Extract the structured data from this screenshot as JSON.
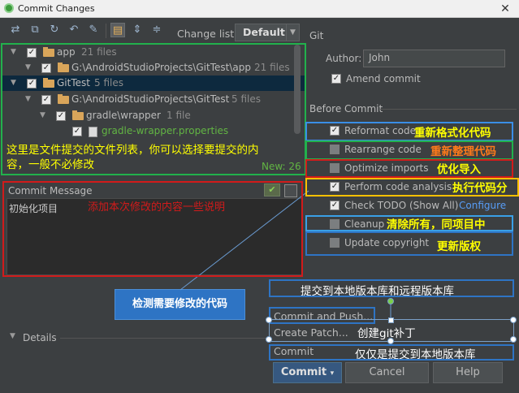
{
  "window": {
    "title": "Commit Changes",
    "close": "✕"
  },
  "toolbar": {
    "changelist_label": "Change list:",
    "changelist_value": "Default"
  },
  "git": {
    "section": "Git",
    "author_label": "Author:",
    "author_value": "John",
    "amend_label": "Amend commit"
  },
  "tree": {
    "rows": [
      {
        "name": "app",
        "count": "21 files"
      },
      {
        "name": "G:\\AndroidStudioProjects\\GitTest\\app",
        "count": "21 files"
      },
      {
        "name": "GitTest",
        "count": "5 files"
      },
      {
        "name": "G:\\AndroidStudioProjects\\GitTest",
        "count": "5 files"
      },
      {
        "name": "gradle\\wrapper",
        "count": "1 file"
      },
      {
        "name": "gradle-wrapper.properties",
        "count": ""
      }
    ],
    "new_count": "New: 26",
    "note": "这里是文件提交的文件列表，你可以选择要提交的内容，一般不必修改"
  },
  "commit_message": {
    "label": "Commit Message",
    "value": "初始化项目",
    "note": "添加本次修改的内容一些说明"
  },
  "before_commit": {
    "title": "Before Commit",
    "options": [
      {
        "label": "Reformat code",
        "checked": true,
        "note": "重新格式化代码"
      },
      {
        "label": "Rearrange code",
        "checked": false,
        "note": "重新整理代码"
      },
      {
        "label": "Optimize imports",
        "checked": false,
        "note": "优化导入"
      },
      {
        "label": "Perform code analysis",
        "checked": true,
        "note": "执行代码分"
      },
      {
        "label": "Check TODO (Show All)",
        "checked": true,
        "configure": "Configure",
        "note": ""
      },
      {
        "label": "Cleanup",
        "checked": false,
        "note": "清除所有，同项目中"
      },
      {
        "label": "Update copyright",
        "checked": false,
        "note": "更新版权"
      }
    ]
  },
  "details": {
    "label": "Details"
  },
  "menu": {
    "items": [
      "Commit and Push...",
      "Create Patch...",
      "Commit"
    ],
    "notes": {
      "push": "提交到本地版本库和远程版本库",
      "patch": "创建git补丁",
      "commit": "仅仅是提交到本地版本库"
    }
  },
  "detect_note": "检测需要修改的代码",
  "buttons": {
    "commit": "Commit",
    "cancel": "Cancel",
    "help": "Help"
  },
  "colors": {
    "background": "#3c3f41",
    "selection": "#0d293e",
    "green": "#62b543",
    "link": "#589df6",
    "annot_blue": "#2e74c4"
  }
}
